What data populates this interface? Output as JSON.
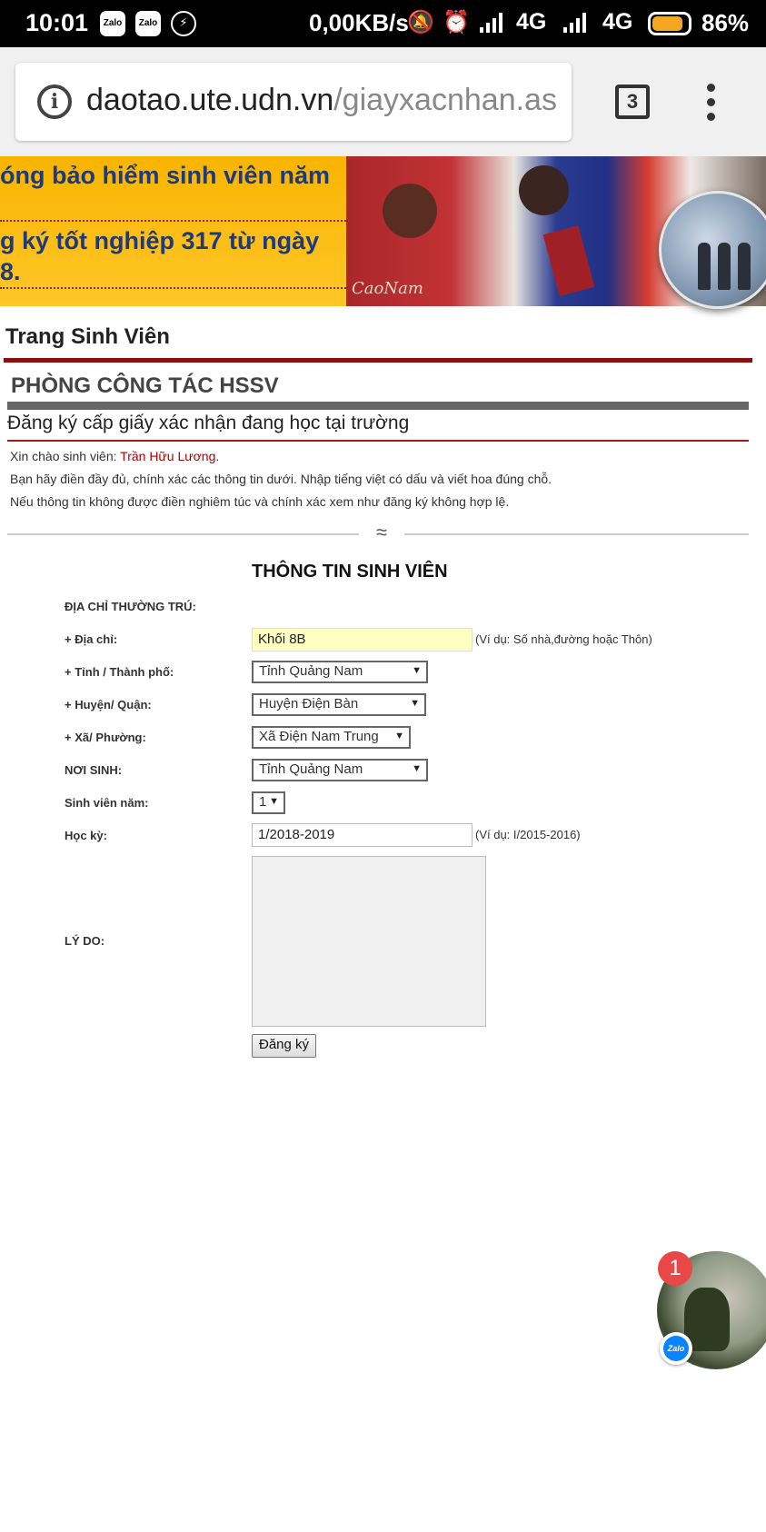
{
  "status_bar": {
    "time": "10:01",
    "notifications": [
      "zalo-icon",
      "zalo-icon",
      "messenger-icon"
    ],
    "app_label": "Zalo",
    "network_speed": "0,00KB/s",
    "network_type_1": "4G",
    "network_type_2": "4G",
    "battery_percent": "86%",
    "battery_level": 0.86
  },
  "browser": {
    "url_host": "daotao.ute.udn.vn",
    "url_path": "/giayxacnhan.as",
    "tab_count": "3"
  },
  "banner": {
    "ticker_lines": [
      "óng bảo hiểm sinh viên năm",
      "g ký tốt nghiệp 317 từ ngày",
      "8."
    ],
    "photo_signature": "CaoNam"
  },
  "page": {
    "title": "Trang Sinh Viên",
    "department": "PHÒNG CÔNG TÁC HSSV",
    "form_title": "Đăng ký cấp giấy xác nhận đang học tại trường",
    "greeting_prefix": "Xin chào sinh viên: ",
    "student_name": "Trần Hữu Lương",
    "greeting_suffix": ".",
    "instruction_1": "Bạn hãy điền đầy đủ, chính xác các thông tin dưới. Nhập tiếng việt có dấu và viết hoa đúng chỗ.",
    "instruction_2": "Nếu thông tin không được điền nghiêm túc và chính xác xem như đăng ký không hợp lệ.",
    "divider_ornament": "≈"
  },
  "form": {
    "section_title": "THÔNG TIN SINH VIÊN",
    "permanent_address_label": "ĐỊA CHỈ THƯỜNG TRÚ:",
    "address_label": "+ Địa chỉ:",
    "address_value": "Khối 8B",
    "address_hint": "(Ví dụ: Số nhà,đường hoặc Thôn)",
    "province_label": "+ Tỉnh / Thành phố:",
    "province_value": "Tỉnh Quảng Nam",
    "district_label": "+ Huyện/ Quận:",
    "district_value": "Huyện Điện Bàn",
    "ward_label": "+ Xã/ Phường:",
    "ward_value": "Xã Điện Nam Trung",
    "birthplace_label": "NƠI SINH:",
    "birthplace_value": "Tỉnh Quảng Nam",
    "year_label": "Sinh viên năm:",
    "year_value": "1",
    "semester_label": "Học kỳ:",
    "semester_value": "1/2018-2019",
    "semester_hint": "(Ví dụ: I/2015-2016)",
    "reason_label": "LÝ DO:",
    "reason_value": "",
    "submit_label": "Đăng ký"
  },
  "chat_head": {
    "unread_count": "1",
    "app_badge": "Zalo"
  }
}
